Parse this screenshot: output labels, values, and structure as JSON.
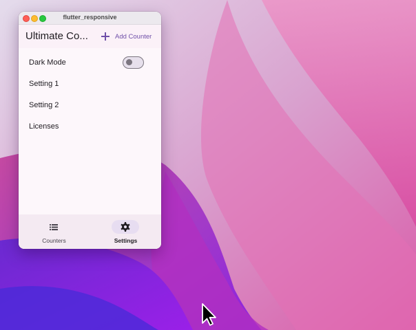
{
  "window": {
    "title": "flutter_responsive"
  },
  "appbar": {
    "title": "Ultimate Co...",
    "add_counter_label": "Add Counter"
  },
  "settings": {
    "items": [
      {
        "label": "Dark Mode",
        "type": "toggle",
        "value": false
      },
      {
        "label": "Setting 1"
      },
      {
        "label": "Setting 2"
      },
      {
        "label": "Licenses"
      }
    ]
  },
  "bottom_nav": {
    "items": [
      {
        "label": "Counters",
        "icon": "list-icon",
        "selected": false
      },
      {
        "label": "Settings",
        "icon": "gear-icon",
        "selected": true
      }
    ]
  },
  "colors": {
    "accent": "#6f4fa8",
    "surface": "#fdf7fb",
    "nav_indicator": "#e7ddf1"
  }
}
